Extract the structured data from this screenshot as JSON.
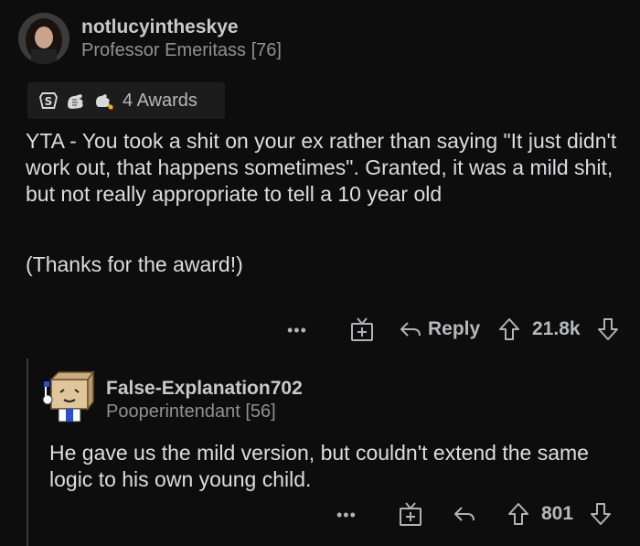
{
  "comment": {
    "username": "notlucyintheskye",
    "flair": "Professor Emeritass [76]",
    "awards_label": "4 Awards",
    "award_icons": [
      "silver-award-icon",
      "wholesome-award-icon",
      "rocket-like-award-icon"
    ],
    "paragraphs": [
      "YTA - You took a shit on your ex rather than saying \"It just didn't work out, that happens sometimes\". Granted, it was a mild shit, but not really appropriate to tell a 10 year old",
      "(Thanks for the award!)"
    ],
    "actions": {
      "more": "•••",
      "reply_label": "Reply",
      "score": "21.8k"
    }
  },
  "reply": {
    "username": "False-Explanation702",
    "flair": "Pooperintendant [56]",
    "paragraphs": [
      "He gave us the mild version, but couldn't extend the same logic to his own young child."
    ],
    "actions": {
      "more": "•••",
      "score": "801"
    }
  },
  "colors": {
    "background": "#0d0d0d",
    "text": "#dcdddf",
    "muted": "#8f9193",
    "awards_bg": "#1c1c1c"
  }
}
